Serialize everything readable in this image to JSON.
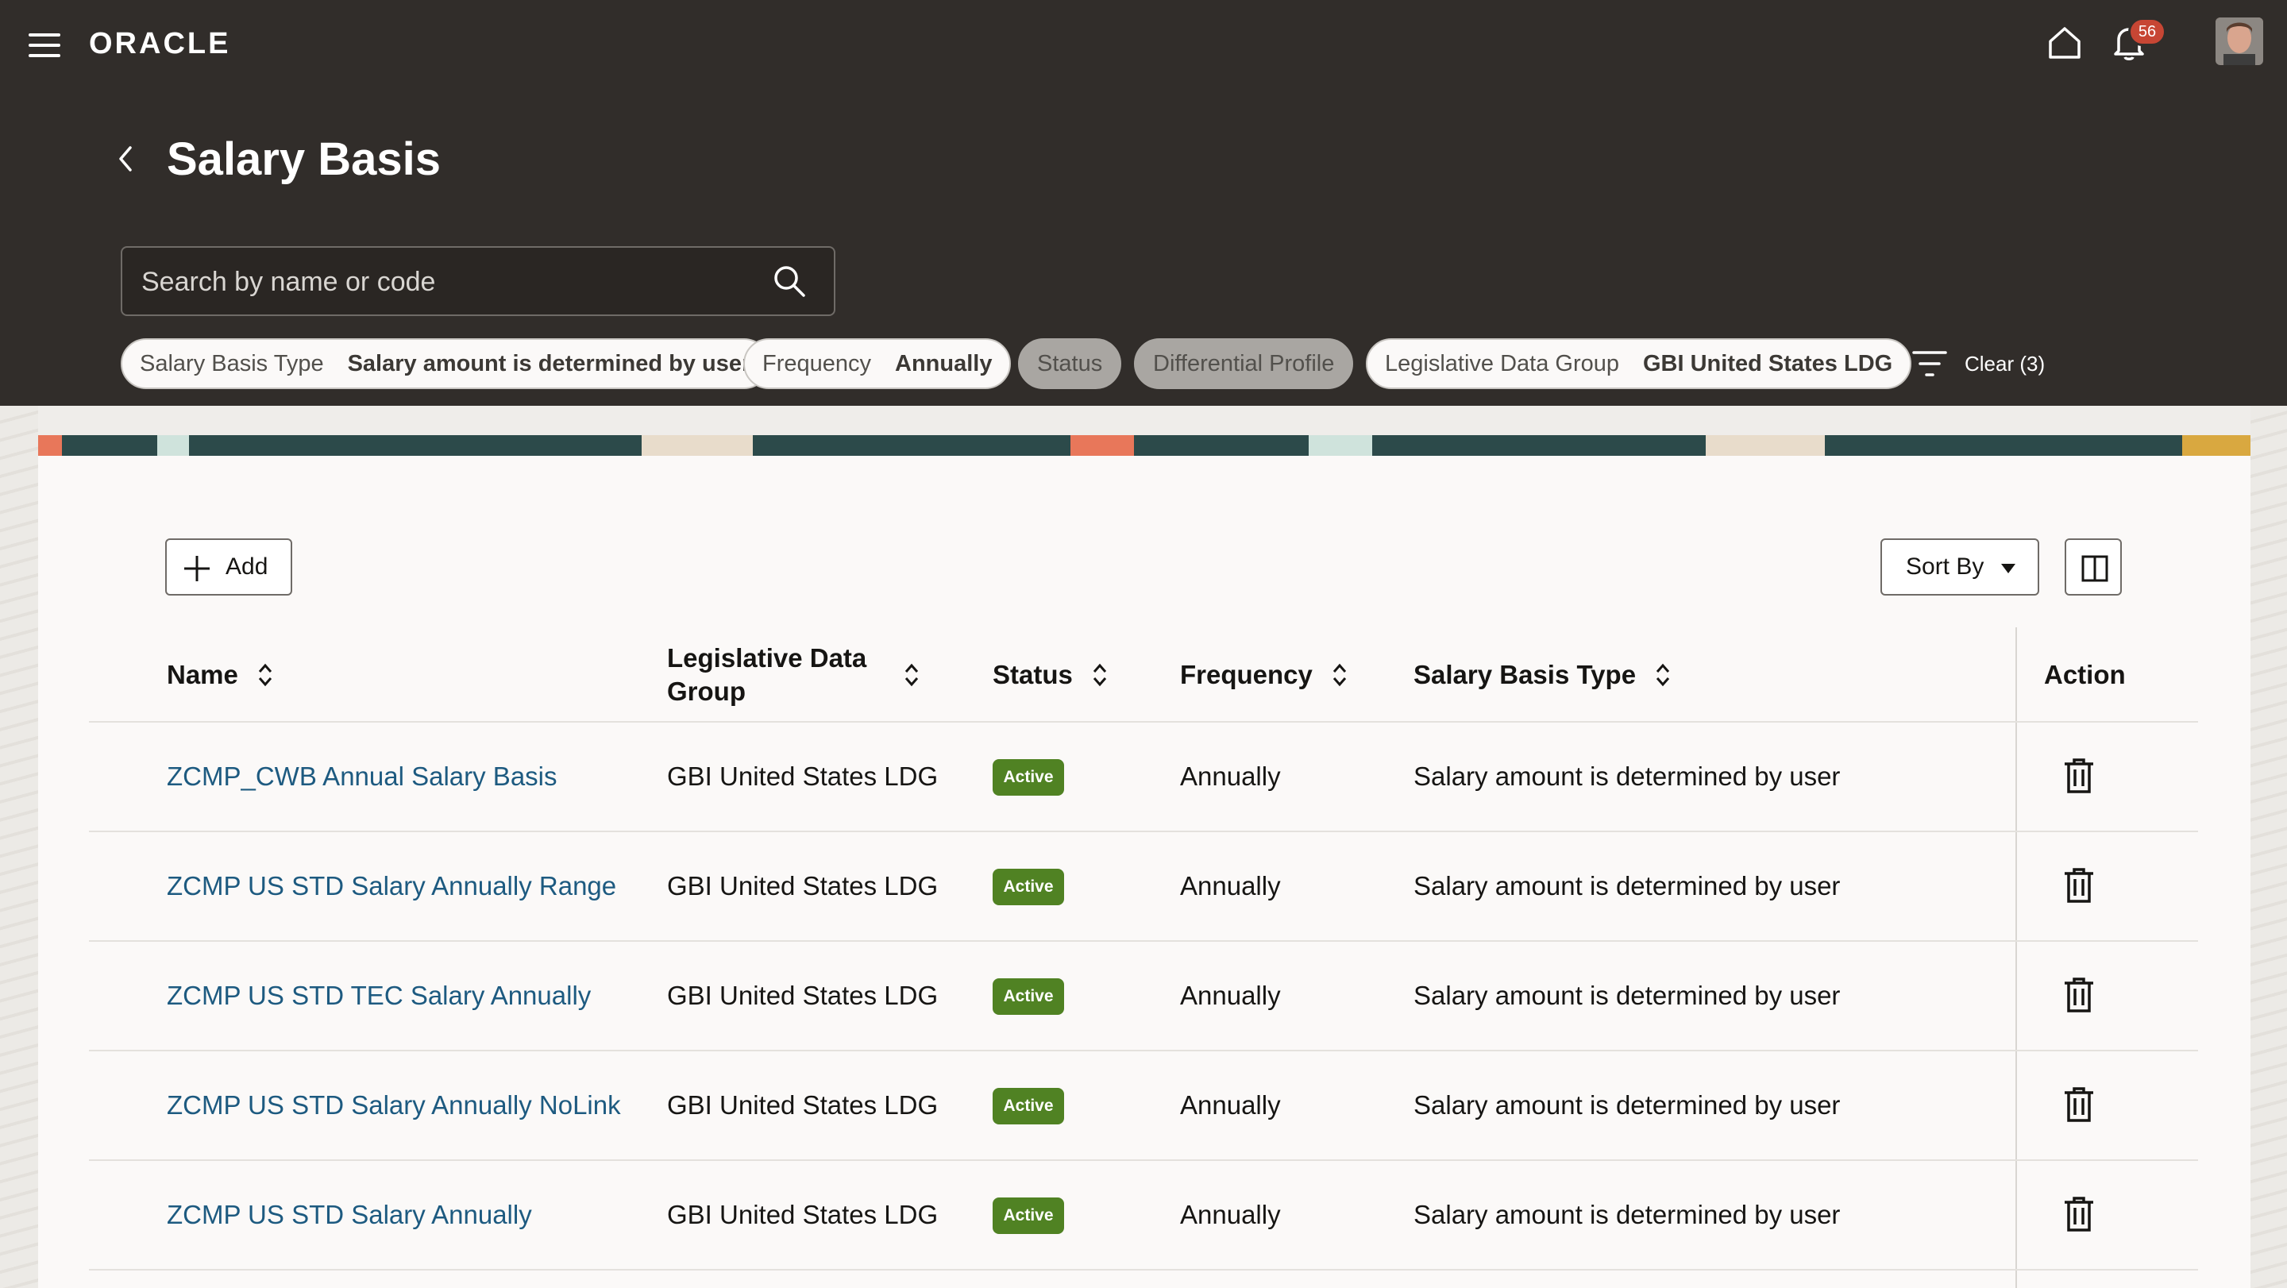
{
  "header": {
    "logo": "ORACLE",
    "notification_count": "56"
  },
  "page": {
    "title": "Salary Basis"
  },
  "search": {
    "placeholder": "Search by name or code"
  },
  "filters": [
    {
      "label": "Salary Basis Type",
      "value": "Salary amount is determined by user"
    },
    {
      "label": "Frequency",
      "value": "Annually"
    },
    {
      "label": "Status",
      "value": ""
    },
    {
      "label": "Differential Profile",
      "value": ""
    },
    {
      "label": "Legislative Data Group",
      "value": "GBI United States LDG"
    }
  ],
  "clear_label": "Clear (3)",
  "toolbar": {
    "add_label": "Add",
    "sort_label": "Sort By"
  },
  "table": {
    "columns": [
      "Name",
      "Legislative Data Group",
      "Status",
      "Frequency",
      "Salary Basis Type",
      "Action"
    ],
    "rows": [
      {
        "name": "ZCMP_CWB Annual Salary Basis",
        "ldg": "GBI United States LDG",
        "status": "Active",
        "frequency": "Annually",
        "type": "Salary amount is determined by user"
      },
      {
        "name": "ZCMP US STD Salary Annually Range",
        "ldg": "GBI United States LDG",
        "status": "Active",
        "frequency": "Annually",
        "type": "Salary amount is determined by user"
      },
      {
        "name": "ZCMP US STD TEC Salary Annually",
        "ldg": "GBI United States LDG",
        "status": "Active",
        "frequency": "Annually",
        "type": "Salary amount is determined by user"
      },
      {
        "name": "ZCMP US STD Salary Annually NoLink",
        "ldg": "GBI United States LDG",
        "status": "Active",
        "frequency": "Annually",
        "type": "Salary amount is determined by user"
      },
      {
        "name": "ZCMP US STD Salary Annually",
        "ldg": "GBI United States LDG",
        "status": "Active",
        "frequency": "Annually",
        "type": "Salary amount is determined by user"
      }
    ]
  },
  "colors": {
    "header_bg": "#312d2a",
    "link": "#1d5a80",
    "active_badge": "#508223",
    "notification_badge": "#c74634"
  }
}
